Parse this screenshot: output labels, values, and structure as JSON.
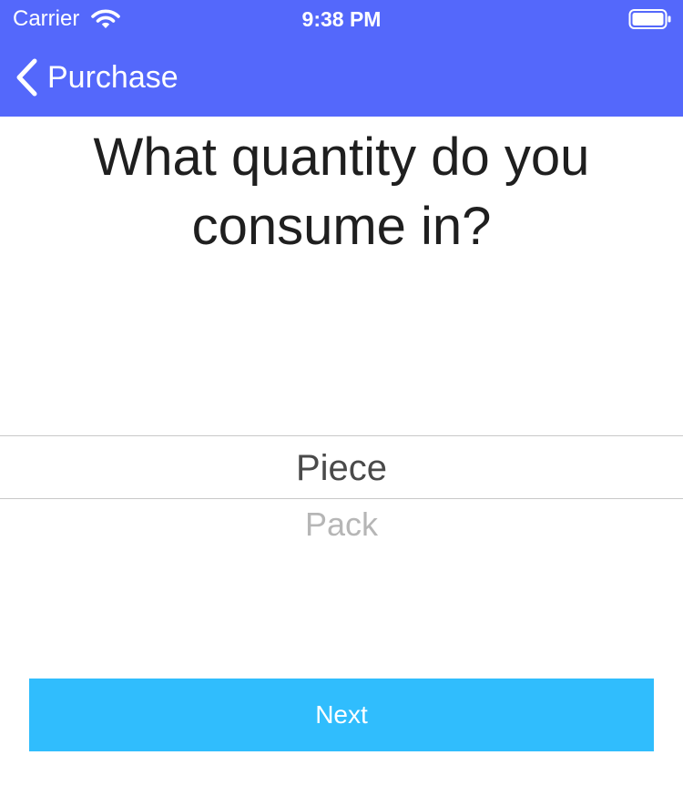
{
  "status_bar": {
    "carrier": "Carrier",
    "time": "9:38 PM"
  },
  "nav": {
    "back_label": "Purchase"
  },
  "question": "What quantity do you consume in?",
  "picker": {
    "selected": "Piece",
    "options": [
      "Piece",
      "Pack"
    ]
  },
  "next_button": {
    "label": "Next"
  },
  "colors": {
    "header_bg": "#5468fb",
    "button_bg": "#30bdfd",
    "question_text": "#1f1f1f",
    "picker_selected_text": "#4a4a4a",
    "picker_unselected_text": "#b6b6b6"
  },
  "icons": [
    "wifi-icon",
    "battery-icon",
    "back-chevron-icon"
  ]
}
